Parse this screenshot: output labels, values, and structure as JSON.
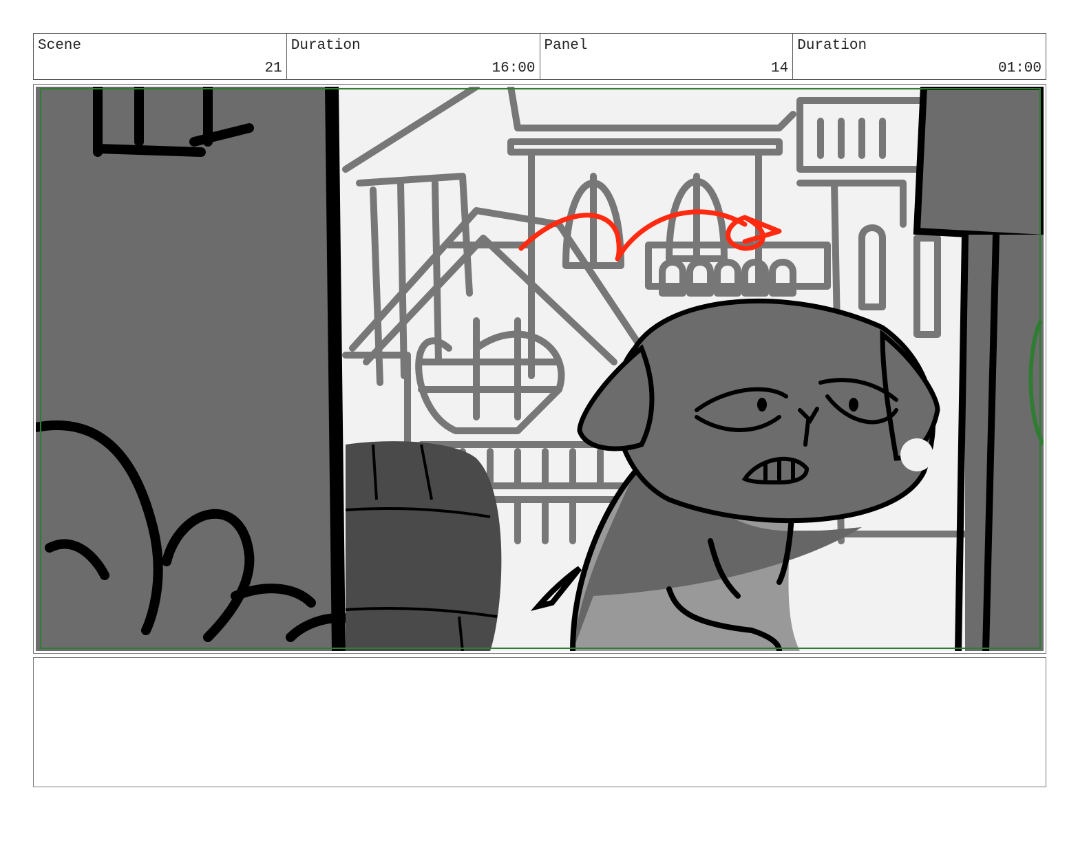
{
  "header": {
    "scene_label": "Scene",
    "scene_value": "21",
    "scene_duration_label": "Duration",
    "scene_duration_value": "16:00",
    "panel_label": "Panel",
    "panel_value": "14",
    "panel_duration_label": "Duration",
    "panel_duration_value": "01:00"
  },
  "panel": {
    "safe_frame_color": "#2e7d32",
    "arrow_color": "#ff2a10",
    "ink_color": "#000000"
  },
  "notes": {
    "text": ""
  }
}
